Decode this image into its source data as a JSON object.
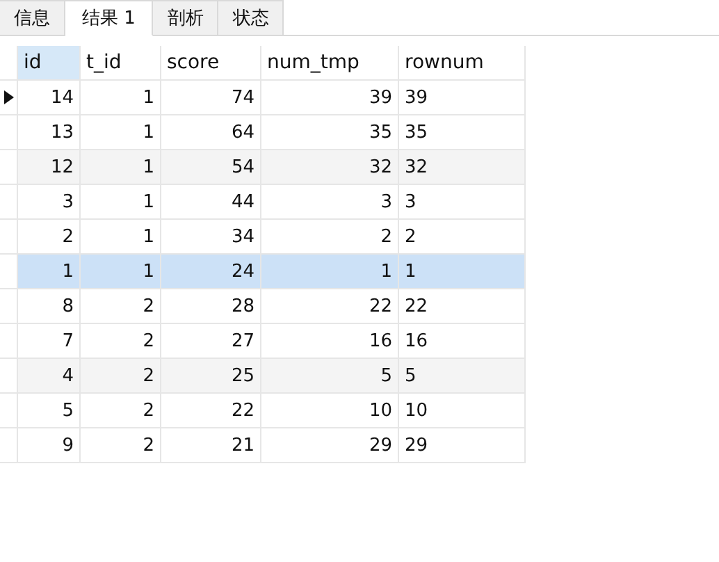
{
  "tabs": [
    {
      "label": "信息",
      "selected": false
    },
    {
      "label": "结果 1",
      "selected": true
    },
    {
      "label": "剖析",
      "selected": false
    },
    {
      "label": "状态",
      "selected": false
    }
  ],
  "table": {
    "columns": [
      {
        "label": "id",
        "kind": "number",
        "selected": true
      },
      {
        "label": "t_id",
        "kind": "number",
        "selected": false
      },
      {
        "label": "score",
        "kind": "number",
        "selected": false
      },
      {
        "label": "num_tmp",
        "kind": "number",
        "selected": false
      },
      {
        "label": "rownum",
        "kind": "text",
        "selected": false
      }
    ],
    "rows": [
      {
        "cells": [
          "14",
          "1",
          "74",
          "39",
          "39"
        ],
        "selected": true,
        "highlighted": false,
        "shaded": false
      },
      {
        "cells": [
          "13",
          "1",
          "64",
          "35",
          "35"
        ],
        "selected": false,
        "highlighted": false,
        "shaded": false
      },
      {
        "cells": [
          "12",
          "1",
          "54",
          "32",
          "32"
        ],
        "selected": false,
        "highlighted": false,
        "shaded": true
      },
      {
        "cells": [
          "3",
          "1",
          "44",
          "3",
          "3"
        ],
        "selected": false,
        "highlighted": false,
        "shaded": false
      },
      {
        "cells": [
          "2",
          "1",
          "34",
          "2",
          "2"
        ],
        "selected": false,
        "highlighted": false,
        "shaded": false
      },
      {
        "cells": [
          "1",
          "1",
          "24",
          "1",
          "1"
        ],
        "selected": false,
        "highlighted": true,
        "shaded": false
      },
      {
        "cells": [
          "8",
          "2",
          "28",
          "22",
          "22"
        ],
        "selected": false,
        "highlighted": false,
        "shaded": false
      },
      {
        "cells": [
          "7",
          "2",
          "27",
          "16",
          "16"
        ],
        "selected": false,
        "highlighted": false,
        "shaded": false
      },
      {
        "cells": [
          "4",
          "2",
          "25",
          "5",
          "5"
        ],
        "selected": false,
        "highlighted": false,
        "shaded": true
      },
      {
        "cells": [
          "5",
          "2",
          "22",
          "10",
          "10"
        ],
        "selected": false,
        "highlighted": false,
        "shaded": false
      },
      {
        "cells": [
          "9",
          "2",
          "21",
          "29",
          "29"
        ],
        "selected": false,
        "highlighted": false,
        "shaded": false
      }
    ]
  }
}
